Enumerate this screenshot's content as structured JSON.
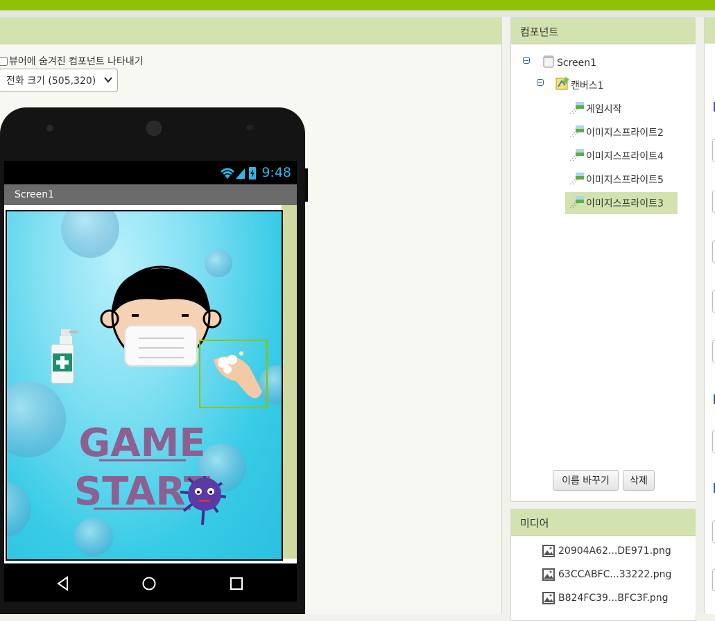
{
  "viewer": {
    "hidden_components_label": "뷰어에 숨겨진 컴포넌트 나타내기",
    "size_select_value": "전화 크기 (505,320)"
  },
  "phone": {
    "status_time": "9:48",
    "screen_title": "Screen1",
    "canvas_text_line1": "GAME",
    "canvas_text_line2": "START"
  },
  "components": {
    "header": "컴포넌트",
    "tree": [
      {
        "label": "Screen1",
        "icon": "screen-icon"
      },
      {
        "label": "캔버스1",
        "icon": "canvas-icon"
      },
      {
        "label": "게임시작",
        "icon": "image-sprite-icon"
      },
      {
        "label": "이미지스프라이트2",
        "icon": "image-sprite-icon"
      },
      {
        "label": "이미지스프라이트4",
        "icon": "image-sprite-icon"
      },
      {
        "label": "이미지스프라이트5",
        "icon": "image-sprite-icon"
      },
      {
        "label": "이미지스프라이트3",
        "icon": "image-sprite-icon",
        "selected": true
      }
    ],
    "rename_button": "이름 바꾸기",
    "delete_button": "삭제"
  },
  "media": {
    "header": "미디어",
    "files": [
      "20904A62...DE971.png",
      "63CCABFC...33222.png",
      "B824FC39...BFC3F.png"
    ]
  },
  "colors": {
    "accent_green": "#8fc202",
    "panel_header": "#d3e3b0",
    "status_blue": "#33b5e5"
  }
}
